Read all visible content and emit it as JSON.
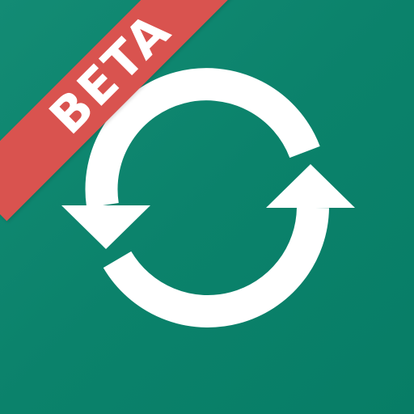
{
  "icon": {
    "name": "sync-icon",
    "background_color": "#0b826b",
    "glyph_color": "#ffffff"
  },
  "ribbon": {
    "label": "BETA",
    "color": "#d9534f"
  }
}
